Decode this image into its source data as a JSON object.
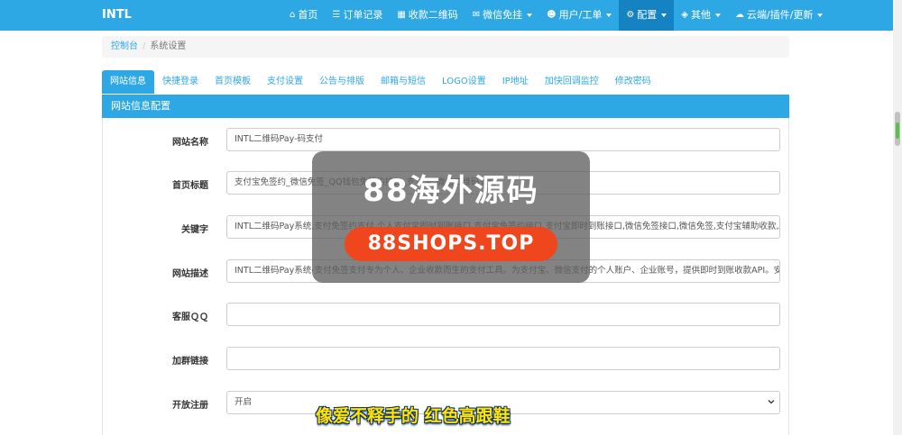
{
  "navbar": {
    "brand": "INTL",
    "items": [
      {
        "icon": "home-icon",
        "glyph": "⌂",
        "label": "首页"
      },
      {
        "icon": "list-icon",
        "glyph": "☰",
        "label": "订单记录"
      },
      {
        "icon": "qrcode-icon",
        "glyph": "▦",
        "label": "收款二维码"
      },
      {
        "icon": "wechat-icon",
        "glyph": "✉",
        "label": "微信免挂"
      },
      {
        "icon": "user-icon",
        "glyph": "☻",
        "label": "用户/工单"
      },
      {
        "icon": "gear-icon",
        "glyph": "⚙",
        "label": "配置"
      },
      {
        "icon": "cube-icon",
        "glyph": "◈",
        "label": "其他"
      },
      {
        "icon": "cloud-icon",
        "glyph": "☁",
        "label": "云端/插件/更新"
      }
    ]
  },
  "breadcrumb": {
    "home": "控制台",
    "separator": "/",
    "current": "系统设置"
  },
  "tabs": [
    "网站信息",
    "快捷登录",
    "首页模板",
    "支付设置",
    "公告与排版",
    "邮箱与短信",
    "LOGO设置",
    "IP地址",
    "加快回调监控",
    "修改密码"
  ],
  "panel": {
    "title": "网站信息配置"
  },
  "form": {
    "site_name": {
      "label": "网站名称",
      "value": "INTL二维码Pay-码支付"
    },
    "home_title": {
      "label": "首页标题",
      "value": "支付宝免签约_微信免签_QQ钱包免签约接口_支付宝_微信二维码支付"
    },
    "keywords": {
      "label": "关键字",
      "value": "INTL二维码Pay系统,支付免签约支付,个人支付宝即时到账接口,支付宝免签约接口,支付宝即时到账接口,微信免签接口,微信免签,支付宝辅助收款,A"
    },
    "description": {
      "label": "网站描述",
      "value": "INTL二维码Pay系统-支付免签支付专为个人、企业收款而生的支付工具。为支付宝、微信支付的个人账户、企业账号，提供即时到账收款API。安"
    },
    "service_qq": {
      "label": "客服ＱＱ",
      "value": ""
    },
    "group_link": {
      "label": "加群链接",
      "value": ""
    },
    "registration": {
      "label": "开放注册",
      "value": "开启"
    }
  },
  "watermark": {
    "title": "88海外源码",
    "url": "88SHOPS.TOP"
  },
  "caption": "像爱不释手的 红色高跟鞋",
  "colors": {
    "primary": "#2ea8e5",
    "active_nav": "#1582c1",
    "watermark_pill": "#f0461e",
    "caption": "#ffe400"
  }
}
